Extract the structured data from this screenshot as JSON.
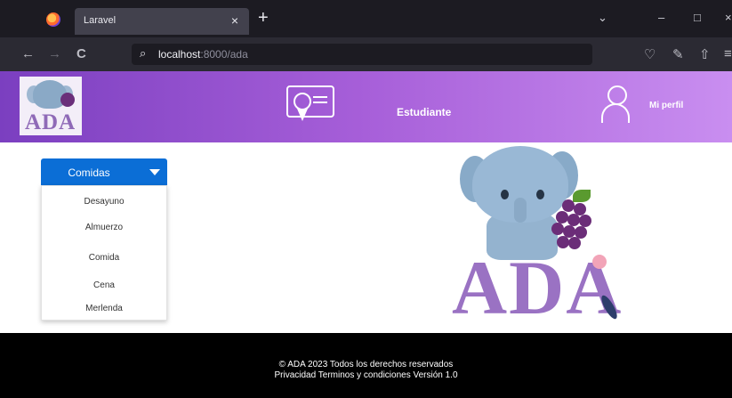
{
  "browser": {
    "tab_title": "Laravel",
    "tab_close": "×",
    "new_tab": "+",
    "url_search_icon": "⌕",
    "url_host": "localhost",
    "url_rest": ":8000/ada",
    "window_controls": [
      "⌄",
      "–",
      "□",
      "×"
    ],
    "nav_icons": [
      "←",
      "→",
      "C"
    ],
    "right_icons": [
      "♡",
      "✎",
      "⇧",
      "≡"
    ]
  },
  "header": {
    "logo_text": "ADA",
    "estudiante_label": "Estudiante",
    "perfil_label": "Mi perfil",
    "gradient": [
      "#7b3fc0",
      "#c98ef0"
    ]
  },
  "dropdown": {
    "button_label": "Comidas",
    "button_color": "#0b6ed6",
    "items": [
      "Desayuno",
      "Almuerzo",
      "Comida",
      "Cena",
      "Merlenda"
    ]
  },
  "hero": {
    "text": "ADA"
  },
  "footer": {
    "line1": "© ADA 2023 Todos los derechos reservados",
    "line2": "Privacidad  Terminos y condiciones Versión 1.0"
  }
}
